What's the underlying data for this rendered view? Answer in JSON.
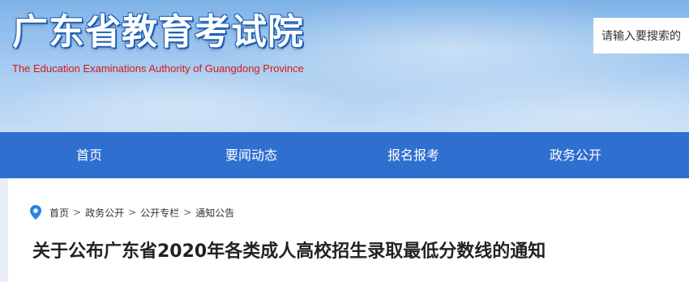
{
  "header": {
    "title": "广东省教育考试院",
    "subtitle": "The Education Examinations Authority of Guangdong Province",
    "search_placeholder": "请输入要搜索的"
  },
  "nav": {
    "items": [
      {
        "label": "首页"
      },
      {
        "label": "要闻动态"
      },
      {
        "label": "报名报考"
      },
      {
        "label": "政务公开"
      }
    ]
  },
  "breadcrumb": {
    "items": [
      "首页",
      "政务公开",
      "公开专栏",
      "通知公告"
    ],
    "separator": ">"
  },
  "article": {
    "title": "关于公布广东省2020年各类成人高校招生录取最低分数线的通知"
  },
  "colors": {
    "nav_bg": "#2f6fd0",
    "subtitle": "#d81818",
    "pin": "#2a84e0"
  }
}
